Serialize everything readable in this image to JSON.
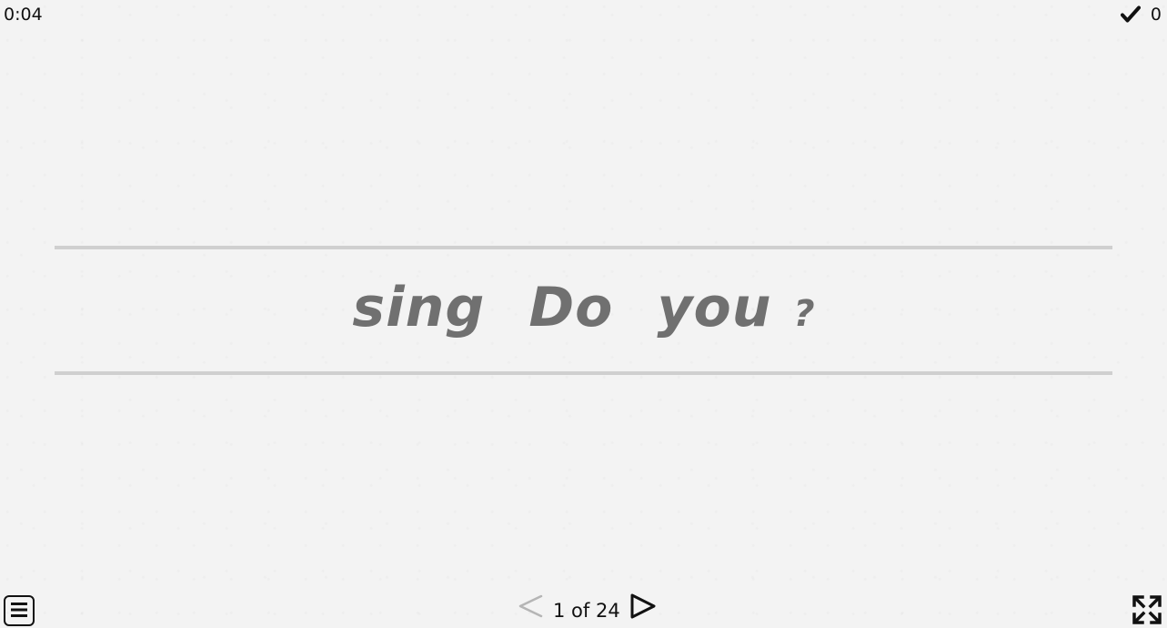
{
  "header": {
    "timer": "0:04",
    "score": "0",
    "score_icon": "check-icon"
  },
  "activity": {
    "words": [
      "sing",
      "Do",
      "you"
    ],
    "punctuation": "?"
  },
  "footer": {
    "menu_icon": "menu-icon",
    "prev_icon": "chevron-left-icon",
    "next_icon": "chevron-right-icon",
    "page_label": "1 of 24",
    "fullscreen_icon": "fullscreen-icon"
  },
  "colors": {
    "background": "#f3f3f3",
    "word_text": "#707070",
    "rule_line": "#cfcfcf",
    "ui_text": "#111111",
    "disabled_arrow": "#b5b5b5"
  }
}
